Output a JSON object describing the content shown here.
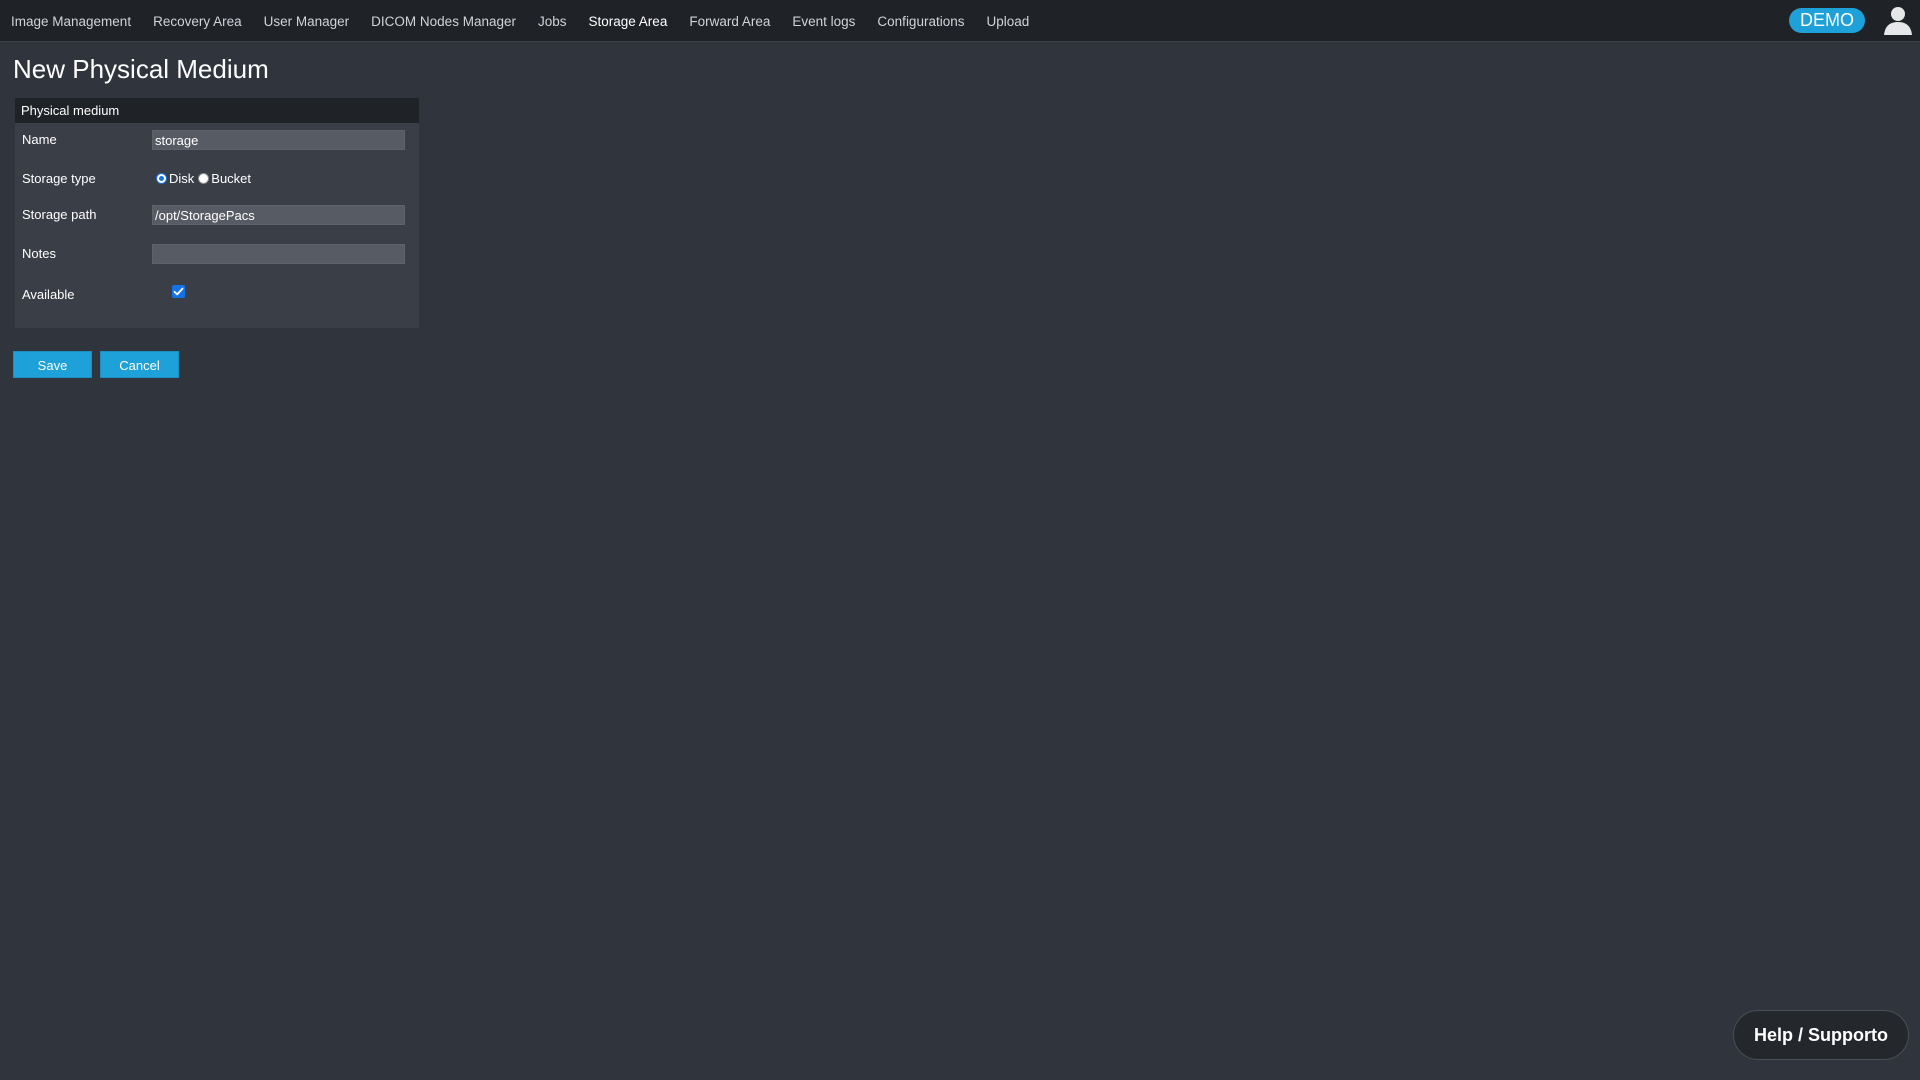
{
  "nav": {
    "items": [
      {
        "label": "Image Management"
      },
      {
        "label": "Recovery Area"
      },
      {
        "label": "User Manager"
      },
      {
        "label": "DICOM Nodes Manager"
      },
      {
        "label": "Jobs"
      },
      {
        "label": "Storage Area",
        "active": true
      },
      {
        "label": "Forward Area"
      },
      {
        "label": "Event logs"
      },
      {
        "label": "Configurations"
      },
      {
        "label": "Upload"
      }
    ],
    "badge": "DEMO",
    "user_icon": "user-icon"
  },
  "page": {
    "title": "New Physical Medium"
  },
  "form": {
    "header": "Physical medium",
    "name_label": "Name",
    "name_value": "storage",
    "storage_type_label": "Storage type",
    "storage_type_options": [
      "Disk",
      "Bucket"
    ],
    "storage_type_selected": "Disk",
    "storage_path_label": "Storage path",
    "storage_path_value": "/opt/StoragePacs",
    "notes_label": "Notes",
    "notes_value": "",
    "available_label": "Available",
    "available_checked": true
  },
  "actions": {
    "save_label": "Save",
    "cancel_label": "Cancel"
  },
  "help": {
    "label": "Help / Supporto"
  },
  "colors": {
    "background": "#30343c",
    "topbar": "#1f2227",
    "accent": "#1ea0d9",
    "panel": "#3a3e46",
    "checkbox": "#1673e6"
  }
}
